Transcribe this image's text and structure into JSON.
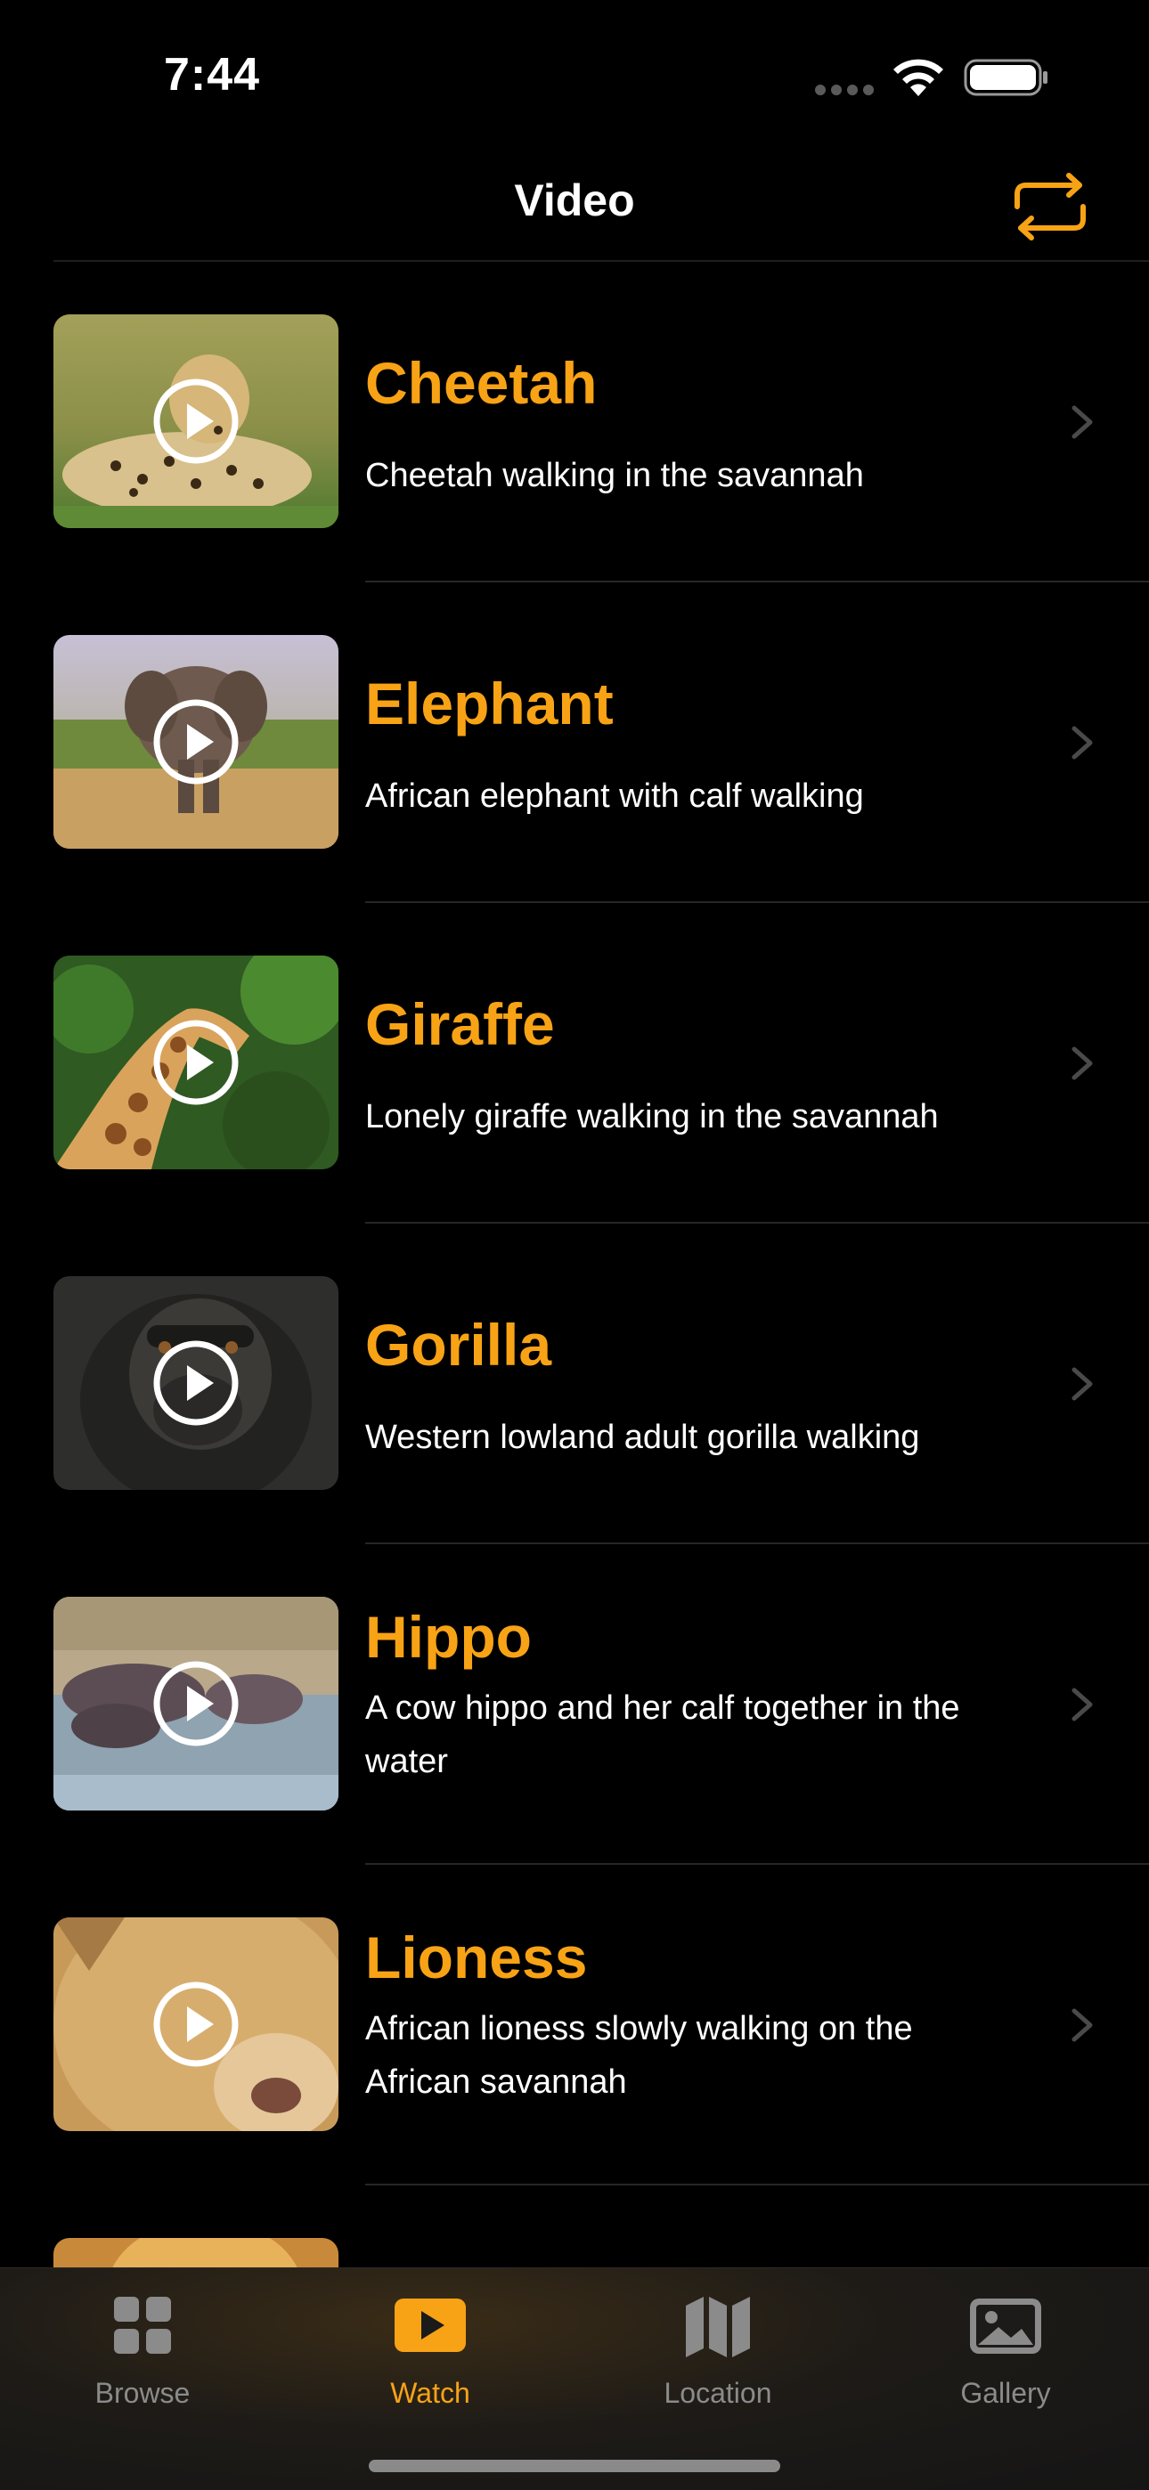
{
  "status_bar": {
    "time": "7:44"
  },
  "nav": {
    "title": "Video",
    "action_icon": "repeat-icon"
  },
  "colors": {
    "accent": "#f8a315",
    "background": "#000000",
    "tab_inactive": "#8b8b8b"
  },
  "videos": [
    {
      "title": "Cheetah",
      "subtitle": "Cheetah walking in the savannah"
    },
    {
      "title": "Elephant",
      "subtitle": "African elephant with calf walking"
    },
    {
      "title": "Giraffe",
      "subtitle": "Lonely giraffe walking in the savannah"
    },
    {
      "title": "Gorilla",
      "subtitle": "Western lowland adult gorilla walking"
    },
    {
      "title": "Hippo",
      "subtitle": "A cow hippo and her calf together in the water"
    },
    {
      "title": "Lioness",
      "subtitle": "African lioness slowly walking on the African savannah"
    }
  ],
  "tabs": [
    {
      "label": "Browse",
      "icon": "grid-icon",
      "active": false
    },
    {
      "label": "Watch",
      "icon": "play-rectangle-icon",
      "active": true
    },
    {
      "label": "Location",
      "icon": "map-icon",
      "active": false
    },
    {
      "label": "Gallery",
      "icon": "photo-icon",
      "active": false
    }
  ]
}
